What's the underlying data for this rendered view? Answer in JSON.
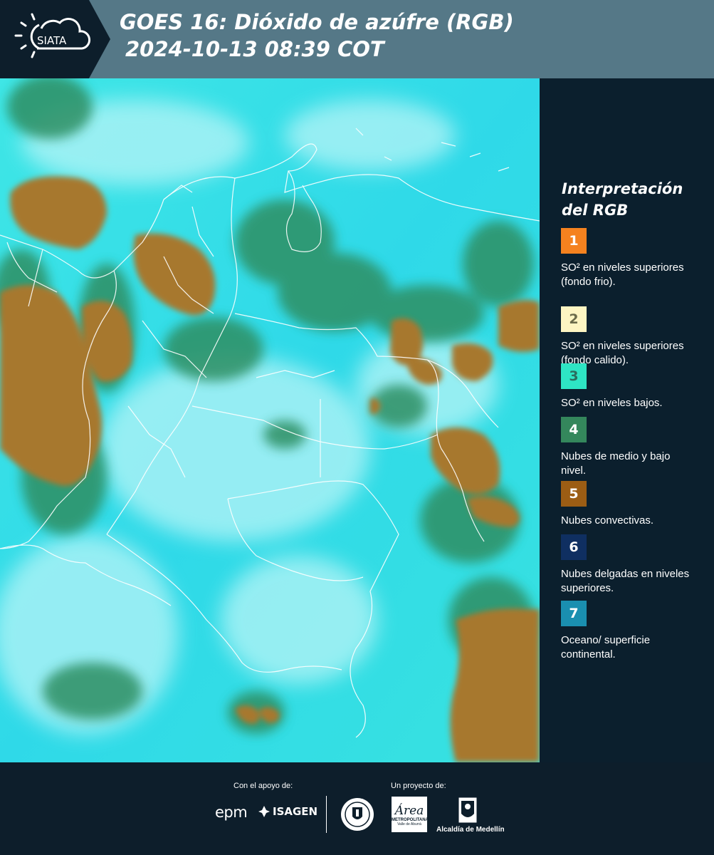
{
  "header": {
    "logo_text": "SIATA",
    "title_line1": "GOES 16: Dióxido de azúfre (RGB)",
    "title_line2": "2024-10-13 08:39 COT"
  },
  "legend": {
    "title_line1": "Interpretación",
    "title_line2": "del RGB",
    "items": [
      {
        "number": "1",
        "color": "#f5821f",
        "text_color": "#ffffff",
        "label": "SO² en niveles superiores (fondo frio)."
      },
      {
        "number": "2",
        "color": "#fdf5c2",
        "text_color": "#6b6b4a",
        "label": "SO² en niveles superiores (fondo calido)."
      },
      {
        "number": "3",
        "color": "#2ee5c4",
        "text_color": "#2b6d5e",
        "label": "SO² en niveles bajos."
      },
      {
        "number": "4",
        "color": "#34875c",
        "text_color": "#ffffff",
        "label": "Nubes de medio y bajo nivel."
      },
      {
        "number": "5",
        "color": "#9c5d14",
        "text_color": "#ffffff",
        "label": "Nubes convectivas."
      },
      {
        "number": "6",
        "color": "#0f2f61",
        "text_color": "#ffffff",
        "label": "Nubes delgadas en niveles superiores."
      },
      {
        "number": "7",
        "color": "#1a8fb0",
        "text_color": "#ffffff",
        "label": "Oceano/ superficie continental."
      }
    ]
  },
  "footer": {
    "support_label": "Con el apoyo de:",
    "project_label": "Un proyecto de:",
    "epm": "epm",
    "isagen": "ISAGEN",
    "area_name": "Área",
    "area_sub": "METROPOLITANA",
    "area_sub2": "Valle de Aburrá",
    "alcaldia": "Alcaldía de Medellín"
  },
  "colors": {
    "header_bg": "#557887",
    "panel_bg": "#0b1f2d",
    "map_cyan": "#2ee3e0",
    "cloud_brown": "#a7782e",
    "cloud_green": "#2f8f63"
  }
}
